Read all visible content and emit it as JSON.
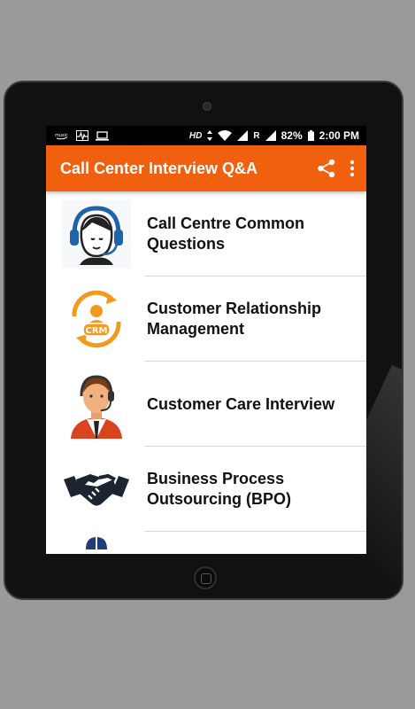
{
  "statusbar": {
    "left_icons": [
      "amazon-music-icon",
      "activity-icon",
      "laptop-icon"
    ],
    "hd_label": "HD",
    "roaming_label": "R",
    "battery": "82%",
    "time": "2:00 PM"
  },
  "appbar": {
    "title": "Call Center Interview Q&A",
    "share_icon": "share-icon",
    "menu_icon": "more-vert-icon"
  },
  "list": {
    "items": [
      {
        "label": "Call Centre Common Questions",
        "icon": "headset-agent-icon"
      },
      {
        "label": "Customer Relationship Management",
        "icon": "crm-cycle-icon"
      },
      {
        "label": "Customer Care Interview",
        "icon": "support-agent-icon"
      },
      {
        "label": "Business Process Outsourcing (BPO)",
        "icon": "handshake-icon"
      }
    ]
  },
  "colors": {
    "accent": "#f0600f",
    "statusbar": "#000000",
    "background": "#9a9a9a"
  }
}
